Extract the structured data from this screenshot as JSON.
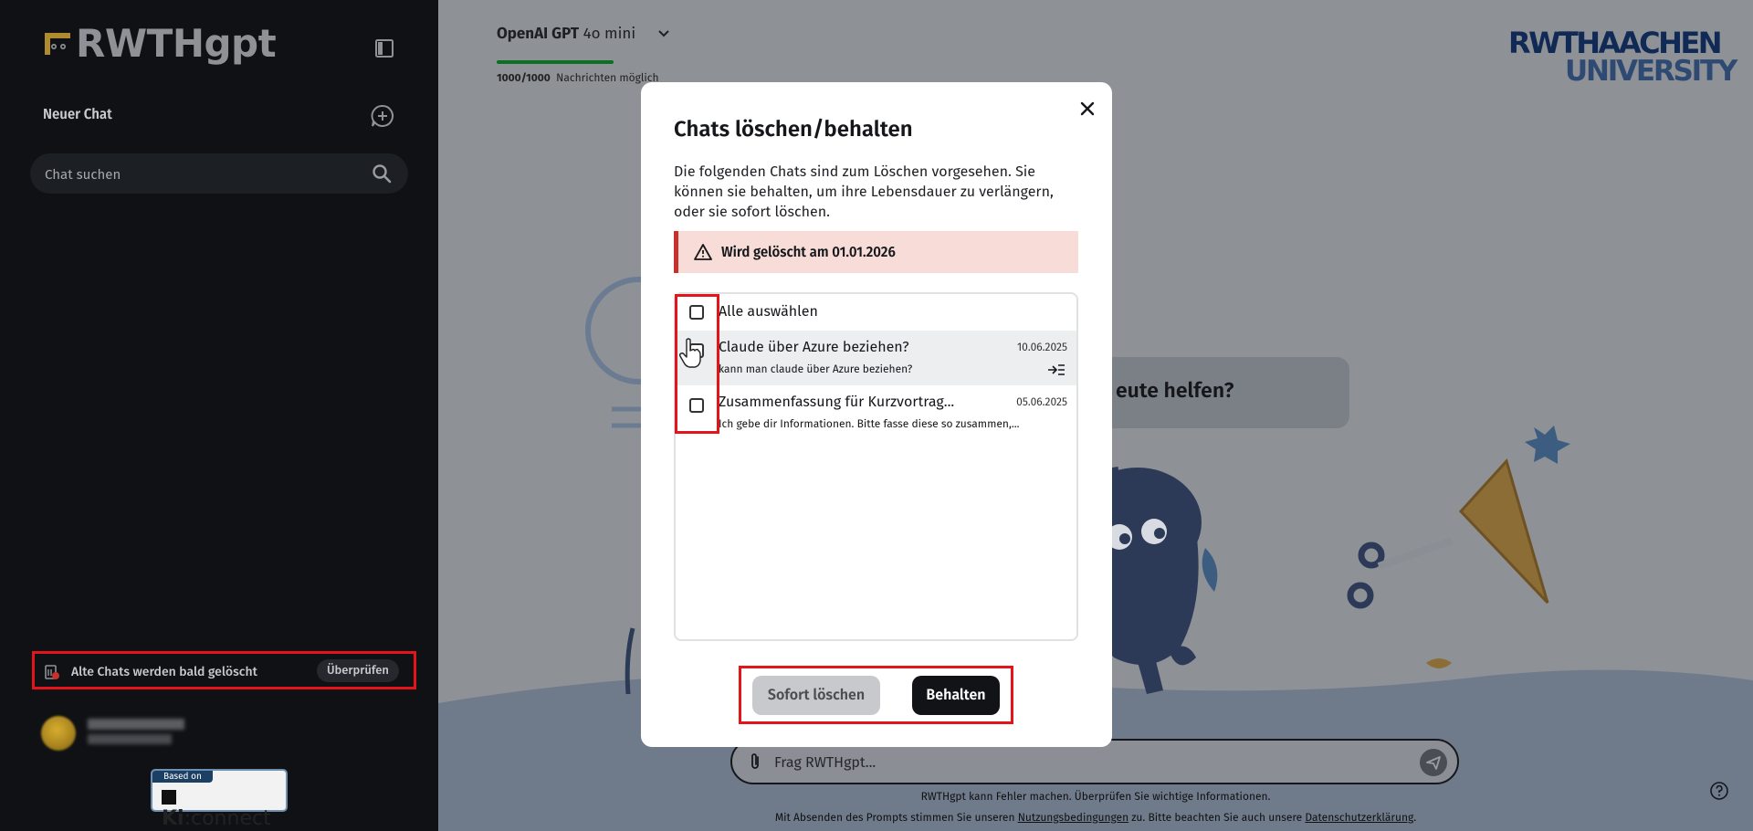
{
  "sidebar": {
    "logo_text": "RWTHgpt",
    "new_chat_label": "Neuer Chat",
    "search_placeholder": "Chat suchen",
    "old_chats_notice": "Alte Chats werden bald gelöscht",
    "review_button": "Überprüfen",
    "based_on_caption": "Based on",
    "based_on_name_a": "Ki",
    "based_on_name_b": ":connect"
  },
  "header": {
    "model_name_bold": "OpenAI GPT",
    "model_name_rest": " 4o mini",
    "quota_bold": "1000/1000",
    "quota_text": "Nachrichten möglich",
    "quota_fraction": 1.0,
    "org_logo_line1": "RWTHAACHEN",
    "org_logo_line2": "UNIVERSITY"
  },
  "main": {
    "greeting_fragment": "eute helfen?",
    "input_placeholder": "Frag RWTHgpt...",
    "disclaimer_line1": "RWTHgpt kann Fehler machen. Überprüfen Sie wichtige Informationen.",
    "disclaimer_line2_a": "Mit Absenden des Prompts stimmen Sie unseren ",
    "terms_link": "Nutzungsbedingungen",
    "disclaimer_line2_b": " zu. Bitte beachten Sie auch unsere ",
    "privacy_link": "Datenschutzerklärung",
    "disclaimer_line2_c": "."
  },
  "modal": {
    "title": "Chats löschen/behalten",
    "description": "Die folgenden Chats sind zum Löschen vorgesehen. Sie können sie behalten, um ihre Lebensdauer zu verlängern, oder sie sofort löschen.",
    "warning": "Wird gelöscht am 01.01.2026",
    "select_all": "Alle auswählen",
    "chats": [
      {
        "title": "Claude über Azure beziehen?",
        "preview": "kann man claude über Azure beziehen?",
        "date": "10.06.2025",
        "checked": false
      },
      {
        "title": "Zusammenfassung für Kurzvortrag...",
        "preview": "Ich gebe dir Informationen. Bitte fasse diese so zusammen,...",
        "date": "05.06.2025",
        "checked": false
      }
    ],
    "delete_button": "Sofort löschen",
    "keep_button": "Behalten"
  },
  "colors": {
    "sidebar_bg": "#0f1114",
    "overlay_bg": "#8e9196",
    "annotation": "#e4141b",
    "warning_bg": "#f8dcd8",
    "progress": "#0e6e24",
    "primary_button": "#111316"
  }
}
